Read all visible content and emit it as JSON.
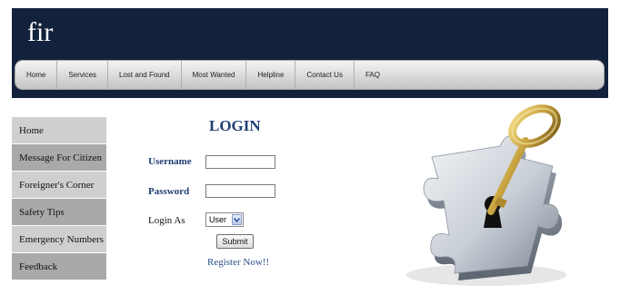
{
  "header": {
    "logo_text": "fir",
    "bg_color": "#13223c",
    "nav": [
      "Home",
      "Services",
      "Lost and Found",
      "Most Wanted",
      "Helpline",
      "Contact Us",
      "FAQ"
    ]
  },
  "sidebar": {
    "items": [
      "Home",
      "Message For Citizen",
      "Foreigner's Corner",
      "Safety Tips",
      "Emergency Numbers",
      "Feedback"
    ]
  },
  "login": {
    "title": "LOGIN",
    "username_label": "Username",
    "username_value": "",
    "password_label": "Password",
    "password_value": "",
    "login_as_label": "Login As",
    "login_as_value": "User",
    "submit_label": "Submit",
    "register_label": "Register Now!!",
    "accent_color": "#1f3f73"
  },
  "illustration": {
    "icon": "key-in-puzzle-icon"
  }
}
